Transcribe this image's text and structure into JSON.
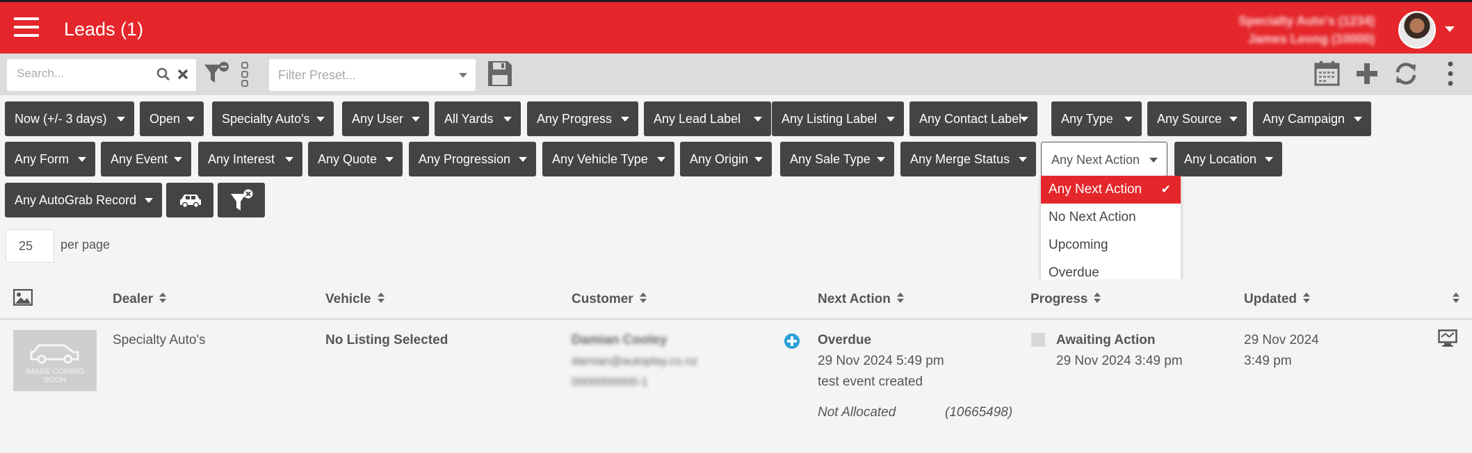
{
  "header": {
    "title": "Leads (1)",
    "user_line1": "Specialty Auto's (1234)",
    "user_line2": "James Leong (10000)"
  },
  "toolbar": {
    "search_placeholder": "Search...",
    "preset_placeholder": "Filter Preset..."
  },
  "filters": {
    "row1": [
      "Now (+/- 3 days)",
      "Open",
      "Specialty Auto's",
      "Any User",
      "All Yards",
      "Any Progress",
      "Any Lead Label",
      "Any Listing Label",
      "Any Contact Label",
      "Any Type",
      "Any Source",
      "Any Campaign"
    ],
    "row2": [
      "Any Form",
      "Any Event",
      "Any Interest",
      "Any Quote",
      "Any Progression",
      "Any Vehicle Type",
      "Any Origin",
      "Any Sale Type",
      "Any Merge Status",
      "Any Next Action",
      "Any Location"
    ],
    "row3": [
      "Any AutoGrab Record"
    ]
  },
  "dropdown": {
    "options": [
      "Any Next Action",
      "No Next Action",
      "Upcoming",
      "Overdue"
    ],
    "selected": "Any Next Action"
  },
  "pagination": {
    "per_page_value": "25",
    "per_page_label": "per page"
  },
  "table": {
    "headers": [
      "Dealer",
      "Vehicle",
      "Customer",
      "Next Action",
      "Progress",
      "Updated"
    ],
    "row": {
      "thumb_text": "IMAGE COMING SOON",
      "dealer": "Specialty Auto's",
      "vehicle": "No Listing Selected",
      "customer_name": "Damian Cooley",
      "customer_email": "damian@autoplay.co.nz",
      "customer_phone": "0000000000-1",
      "next_action_status": "Overdue",
      "next_action_date": "29 Nov 2024 5:49 pm",
      "next_action_note": "test event created",
      "allocation": "Not Allocated",
      "lead_id": "(10665498)",
      "progress_status": "Awaiting Action",
      "progress_date": "29 Nov 2024 3:49 pm",
      "updated_line1": "29 Nov 2024",
      "updated_line2": "3:49 pm"
    }
  },
  "colors": {
    "brand": "#e5262b",
    "button": "#444444",
    "accent_blue": "#2a9fd6"
  }
}
